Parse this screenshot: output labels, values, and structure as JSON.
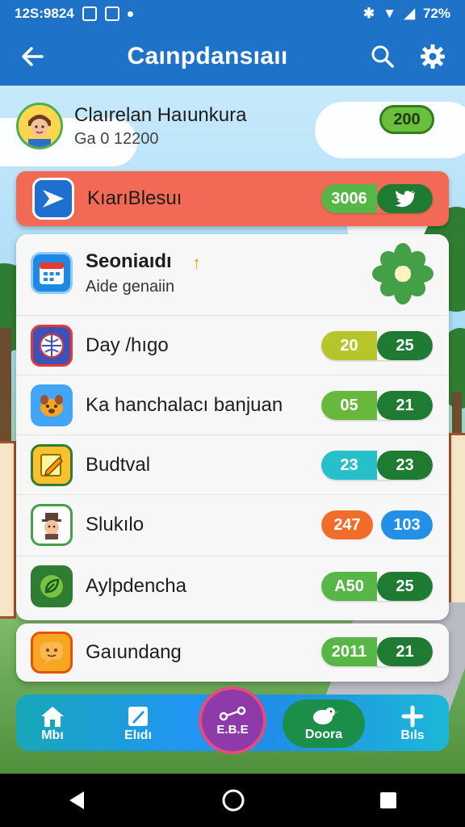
{
  "status_bar": {
    "time": "12S:9824",
    "battery": "72%"
  },
  "app_bar": {
    "title": "Caınpdansıaıı"
  },
  "profile": {
    "name": "Claırelan Haıunkura",
    "subtitle": "Ga 0 12200",
    "badge": "200"
  },
  "hero": {
    "label": "KıarıBlesuı",
    "score_left": "3006"
  },
  "card1": {
    "title": "Seoniaıdı",
    "subtitle": "Aide genaiin",
    "rows": [
      {
        "label": "Day /hıgo",
        "left": "20",
        "right": "25",
        "left_color": "#b7c52a",
        "right_color": "#1f7a32"
      },
      {
        "label": "Ka hanchalacı banjuan",
        "left": "05",
        "right": "21",
        "left_color": "#67b83d",
        "right_color": "#1f7a32"
      },
      {
        "label": "Budtval",
        "left": "23",
        "right": "23",
        "left_color": "#27bfc9",
        "right_color": "#1f7a32"
      },
      {
        "label": "Slukılo",
        "left": "247",
        "right": "103",
        "left_color": "#f26c2a",
        "right_color": "#2190e6"
      },
      {
        "label": "Aylpdencha",
        "left": "A50",
        "right": "25",
        "left_color": "#56b746",
        "right_color": "#1f7a32"
      }
    ]
  },
  "card2": {
    "label": "Gaıundang",
    "left": "2011",
    "right": "21",
    "left_color": "#56b746",
    "right_color": "#1f7a32"
  },
  "bottom_nav": {
    "items": [
      "Mbı",
      "Elıdı",
      "E.B.E",
      "Doora",
      "Bıls"
    ]
  },
  "colors": {
    "primary": "#1e73c8",
    "hero": "#f26a55"
  }
}
